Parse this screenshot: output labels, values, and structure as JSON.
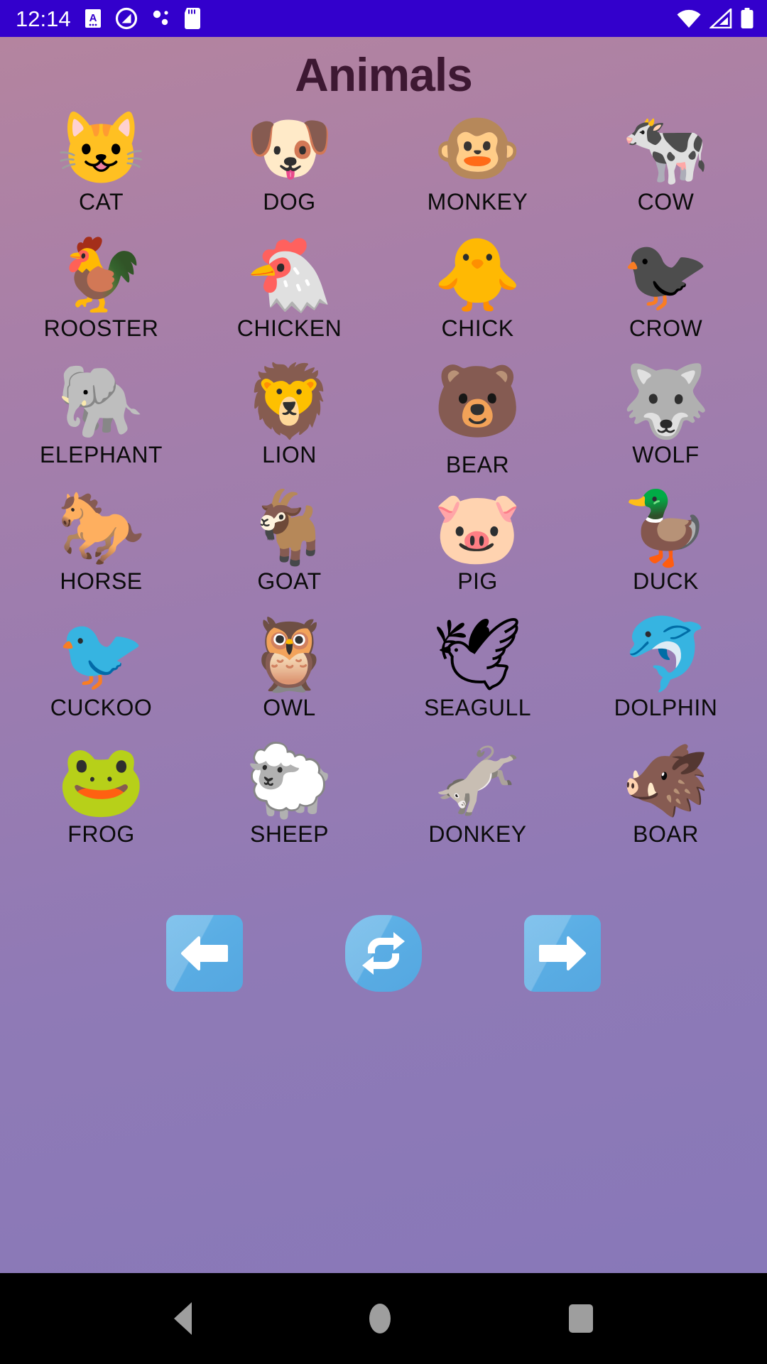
{
  "status_bar": {
    "clock": "12:14",
    "left_icons": [
      {
        "name": "app-badge-icon",
        "glyph": "A"
      },
      {
        "name": "do-not-disturb-icon",
        "glyph": "⊘"
      },
      {
        "name": "bluetooth-dots-icon",
        "glyph": "⁙"
      },
      {
        "name": "sd-card-icon",
        "glyph": "▮"
      }
    ],
    "right_icons": [
      {
        "name": "wifi-icon",
        "label": "wifi-full"
      },
      {
        "name": "cell-signal-icon",
        "label": "signal-partial"
      },
      {
        "name": "battery-icon",
        "label": "battery-full"
      }
    ],
    "background_color": "#3300cc",
    "foreground_color": "#ffffff"
  },
  "header": {
    "title": "Animals",
    "title_color": "#3d1832"
  },
  "theme": {
    "gradient_top": "#b4849f",
    "gradient_bottom": "#8878b8",
    "button_blue": "#5aade4",
    "label_color": "#0b0b0b"
  },
  "grid": {
    "columns": 4,
    "items": [
      {
        "label": "CAT",
        "emoji": "😺",
        "icon_name": "cat-emoji"
      },
      {
        "label": "DOG",
        "emoji": "🐶",
        "icon_name": "dog-emoji"
      },
      {
        "label": "MONKEY",
        "emoji": "🐵",
        "icon_name": "monkey-emoji"
      },
      {
        "label": "COW",
        "emoji": "🐄",
        "icon_name": "cow-emoji"
      },
      {
        "label": "ROOSTER",
        "emoji": "🐓",
        "icon_name": "rooster-emoji"
      },
      {
        "label": "CHICKEN",
        "emoji": "🐔",
        "icon_name": "chicken-emoji"
      },
      {
        "label": "CHICK",
        "emoji": "🐥",
        "icon_name": "chick-emoji"
      },
      {
        "label": "CROW",
        "emoji": "🐦‍⬛",
        "icon_name": "crow-emoji"
      },
      {
        "label": "ELEPHANT",
        "emoji": "🐘",
        "icon_name": "elephant-emoji"
      },
      {
        "label": "LION",
        "emoji": "🦁",
        "icon_name": "lion-emoji"
      },
      {
        "label": "BEAR",
        "emoji": "🐻",
        "icon_name": "bear-emoji"
      },
      {
        "label": "WOLF",
        "emoji": "🐺",
        "icon_name": "wolf-emoji"
      },
      {
        "label": "HORSE",
        "emoji": "🐎",
        "icon_name": "horse-emoji"
      },
      {
        "label": "GOAT",
        "emoji": "🐐",
        "icon_name": "goat-emoji"
      },
      {
        "label": "PIG",
        "emoji": "🐷",
        "icon_name": "pig-emoji"
      },
      {
        "label": "DUCK",
        "emoji": "🦆",
        "icon_name": "duck-emoji"
      },
      {
        "label": "CUCKOO",
        "emoji": "🐦",
        "icon_name": "cuckoo-emoji"
      },
      {
        "label": "OWL",
        "emoji": "🦉",
        "icon_name": "owl-emoji"
      },
      {
        "label": "SEAGULL",
        "emoji": "🕊",
        "icon_name": "seagull-emoji"
      },
      {
        "label": "DOLPHIN",
        "emoji": "🐬",
        "icon_name": "dolphin-emoji"
      },
      {
        "label": "FROG",
        "emoji": "🐸",
        "icon_name": "frog-emoji"
      },
      {
        "label": "SHEEP",
        "emoji": "🐑",
        "icon_name": "sheep-emoji"
      },
      {
        "label": "DONKEY",
        "emoji": "🫏",
        "icon_name": "donkey-emoji"
      },
      {
        "label": "BOAR",
        "emoji": "🐗",
        "icon_name": "boar-emoji"
      }
    ]
  },
  "controls": [
    {
      "name": "previous-page-button",
      "icon": "arrow-left-icon",
      "label": "Previous"
    },
    {
      "name": "shuffle-button",
      "icon": "shuffle-icon",
      "label": "Shuffle"
    },
    {
      "name": "next-page-button",
      "icon": "arrow-right-icon",
      "label": "Next"
    }
  ],
  "nav_bar": {
    "items": [
      {
        "name": "android-back-button",
        "label": "Back"
      },
      {
        "name": "android-home-button",
        "label": "Home"
      },
      {
        "name": "android-recents-button",
        "label": "Recents"
      }
    ]
  }
}
